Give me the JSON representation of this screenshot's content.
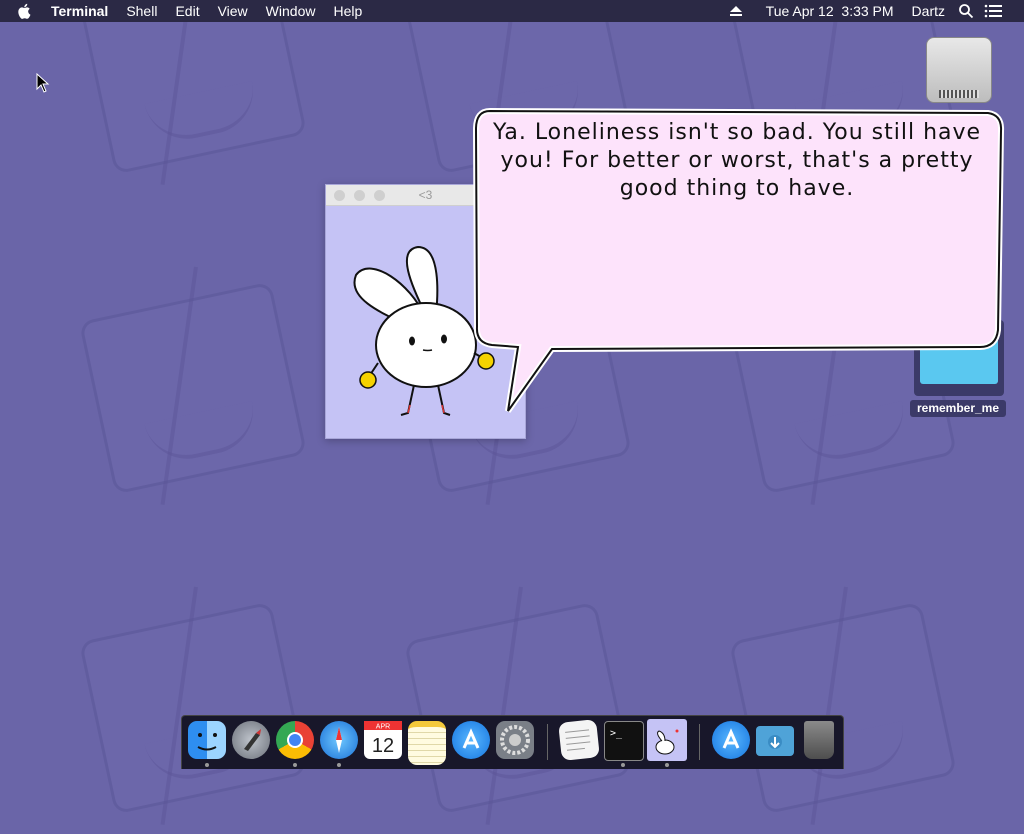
{
  "menubar": {
    "app_name": "Terminal",
    "menus": [
      "Shell",
      "Edit",
      "View",
      "Window",
      "Help"
    ],
    "datetime": "Tue Apr 12  3:33 PM",
    "user": "Dartz"
  },
  "desktop": {
    "folder_label": "remember_me"
  },
  "window": {
    "title": "<3"
  },
  "speech": {
    "text": "Ya. Loneliness isn't so bad. You still have you! For better or worst, that's a pretty good thing to have."
  },
  "dock": {
    "items": [
      {
        "name": "Finder",
        "icon": "finder-icon",
        "running": true
      },
      {
        "name": "Launchpad",
        "icon": "launchpad-icon",
        "running": false
      },
      {
        "name": "Chrome",
        "icon": "chrome-icon",
        "running": true
      },
      {
        "name": "Safari",
        "icon": "safari-icon",
        "running": true
      },
      {
        "name": "Calendar",
        "icon": "calendar-icon",
        "running": false,
        "month": "APR",
        "day": "12"
      },
      {
        "name": "Notes",
        "icon": "notes-icon",
        "running": false
      },
      {
        "name": "App Store",
        "icon": "app-store-icon",
        "running": false
      },
      {
        "name": "System Preferences",
        "icon": "system-preferences-icon",
        "running": false
      },
      {
        "name": "TextEdit",
        "icon": "textedit-icon",
        "running": false
      },
      {
        "name": "Terminal",
        "icon": "terminal-icon",
        "running": true
      },
      {
        "name": "Bunny",
        "icon": "bunny-icon",
        "running": true
      },
      {
        "name": "Applications",
        "icon": "applications-folder-icon",
        "running": false
      },
      {
        "name": "Downloads",
        "icon": "downloads-folder-icon",
        "running": false
      },
      {
        "name": "Trash",
        "icon": "trash-icon",
        "running": false
      }
    ]
  },
  "colors": {
    "desktop": "#6a65a8",
    "menubar": "#2b2945",
    "bubble_fill": "#fde3fb",
    "window_content": "#c5c3f5"
  }
}
